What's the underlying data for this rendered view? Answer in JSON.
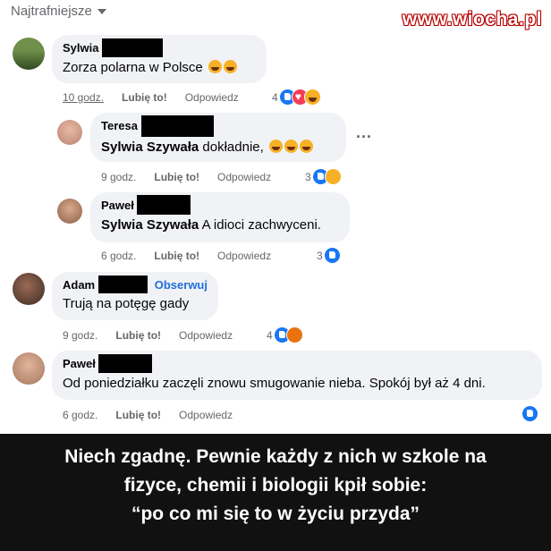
{
  "sort": {
    "label": "Najtrafniejsze"
  },
  "watermark": "www.wiocha.pl",
  "comments": [
    {
      "name": "Sylwia",
      "text": "Zorza polarna w Polsce",
      "time": "10 godz.",
      "like": "Lubię to!",
      "reply": "Odpowiedz",
      "count": "4"
    },
    {
      "name": "Teresa",
      "mention": "Sylwia Szywała",
      "text": " dokładnie,",
      "time": "9 godz.",
      "like": "Lubię to!",
      "reply": "Odpowiedz",
      "count": "3"
    },
    {
      "name": "Paweł",
      "mention": "Sylwia Szywała",
      "text": " A idioci zachwyceni.",
      "time": "6 godz.",
      "like": "Lubię to!",
      "reply": "Odpowiedz",
      "count": "3"
    },
    {
      "name": "Adam",
      "follow": "Obserwuj",
      "text": "Trują na potęgę gady",
      "time": "9 godz.",
      "like": "Lubię to!",
      "reply": "Odpowiedz",
      "count": "4"
    },
    {
      "name": "Paweł",
      "text": "Od poniedziałku zaczęli znowu smugowanie nieba. Spokój był aż 4 dni.",
      "time": "6 godz.",
      "like": "Lubię to!",
      "reply": "Odpowiedz"
    }
  ],
  "more": "...",
  "caption": {
    "line1": "Niech zgadnę.  Pewnie każdy z nich w szkole na",
    "line2": "fizyce, chemii i biologii kpił sobie:",
    "line3": "“po co mi się to w życiu przyda”"
  }
}
